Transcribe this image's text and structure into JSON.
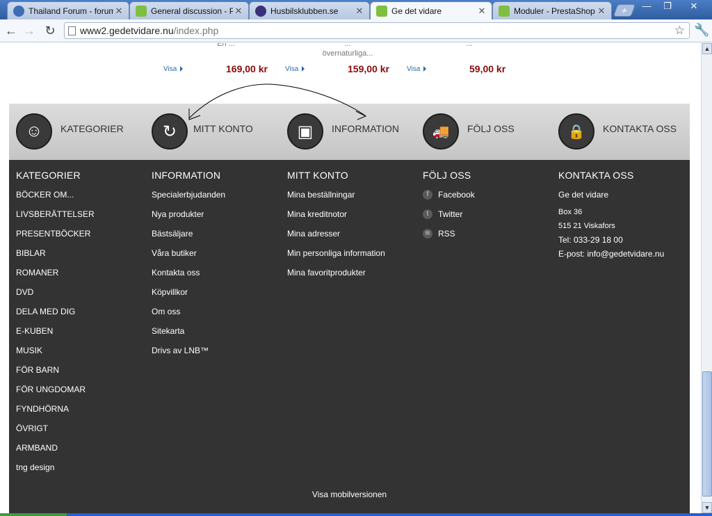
{
  "browser": {
    "tabs": [
      {
        "title": "Thailand Forum - forum om",
        "icon": "thailand-forum-favicon",
        "active": false
      },
      {
        "title": "General discussion - Presta",
        "icon": "prestashop-favicon",
        "active": false
      },
      {
        "title": "Husbilsklubben.se",
        "icon": "husbilsklubben-favicon",
        "active": false
      },
      {
        "title": "Ge det vidare",
        "icon": "prestashop-favicon",
        "active": true
      },
      {
        "title": "Moduler - PrestaShop™",
        "icon": "prestashop-favicon",
        "active": false
      }
    ],
    "new_tab_label": "+",
    "window_buttons": {
      "minimize": "—",
      "maximize": "❐",
      "close": "✕"
    },
    "url_host": "www2.gedetvidare.nu",
    "url_path": "/index.php",
    "back_label": "←",
    "forward_label": "→",
    "reload_label": "↻",
    "star_label": "☆",
    "wrench_label": "🔧"
  },
  "products": [
    {
      "desc_line1": "En ...",
      "desc_line2": "",
      "visa": "Visa",
      "price": "169,00 kr"
    },
    {
      "desc_line1": "...",
      "desc_line2": "övernaturliga...",
      "visa": "Visa",
      "price": "159,00 kr"
    },
    {
      "desc_line1": "...",
      "desc_line2": "",
      "visa": "Visa",
      "price": "59,00 kr"
    }
  ],
  "quickbar": [
    {
      "label": "KATEGORIER",
      "icon": "smiley-icon",
      "glyph": "☺"
    },
    {
      "label": "MITT KONTO",
      "icon": "refresh-icon",
      "glyph": "↻"
    },
    {
      "label": "INFORMATION",
      "icon": "id-card-icon",
      "glyph": "▣"
    },
    {
      "label": "FÖLJ OSS",
      "icon": "truck-icon",
      "glyph": "🚚"
    },
    {
      "label": "KONTAKTA OSS",
      "icon": "lock-icon",
      "glyph": "🔒"
    }
  ],
  "footer": {
    "categories": {
      "heading": "KATEGORIER",
      "items": [
        "BÖCKER OM...",
        "LIVSBERÄTTELSER",
        "PRESENTBÖCKER",
        "BIBLAR",
        "ROMANER",
        "DVD",
        "DELA MED DIG",
        "E-KUBEN",
        "MUSIK",
        "FÖR BARN",
        "FÖR UNGDOMAR",
        "FYNDHÖRNA",
        "ÖVRIGT",
        "ARMBAND",
        "tng design"
      ]
    },
    "information": {
      "heading": "INFORMATION",
      "items": [
        "Specialerbjudanden",
        "Nya produkter",
        "Bästsäljare",
        "Våra butiker",
        "Kontakta oss",
        "Köpvillkor",
        "Om oss",
        "Sitekarta",
        "Drivs av LNB™"
      ]
    },
    "account": {
      "heading": "MITT KONTO",
      "items": [
        "Mina beställningar",
        "Mina kreditnotor",
        "Mina adresser",
        "Min personliga information",
        "Mina favoritprodukter"
      ]
    },
    "follow": {
      "heading": "FÖLJ OSS",
      "items": [
        {
          "label": "Facebook",
          "icon": "facebook-icon",
          "glyph": "f"
        },
        {
          "label": "Twitter",
          "icon": "twitter-icon",
          "glyph": "t"
        },
        {
          "label": "RSS",
          "icon": "rss-icon",
          "glyph": "≋"
        }
      ]
    },
    "contact": {
      "heading": "KONTAKTA OSS",
      "name": "Ge det vidare",
      "box": "Box 36",
      "postal": "515 21 Viskafors",
      "tel": "Tel: 033-29 18 00",
      "email": "E-post: info@gedetvidare.nu"
    },
    "mobile_link": "Visa mobilversionen"
  },
  "colors": {
    "price": "#8b0a0a",
    "link": "#2b6aa8",
    "footer_bg": "#333333",
    "quickbar_bg": "#cfcfcf"
  }
}
